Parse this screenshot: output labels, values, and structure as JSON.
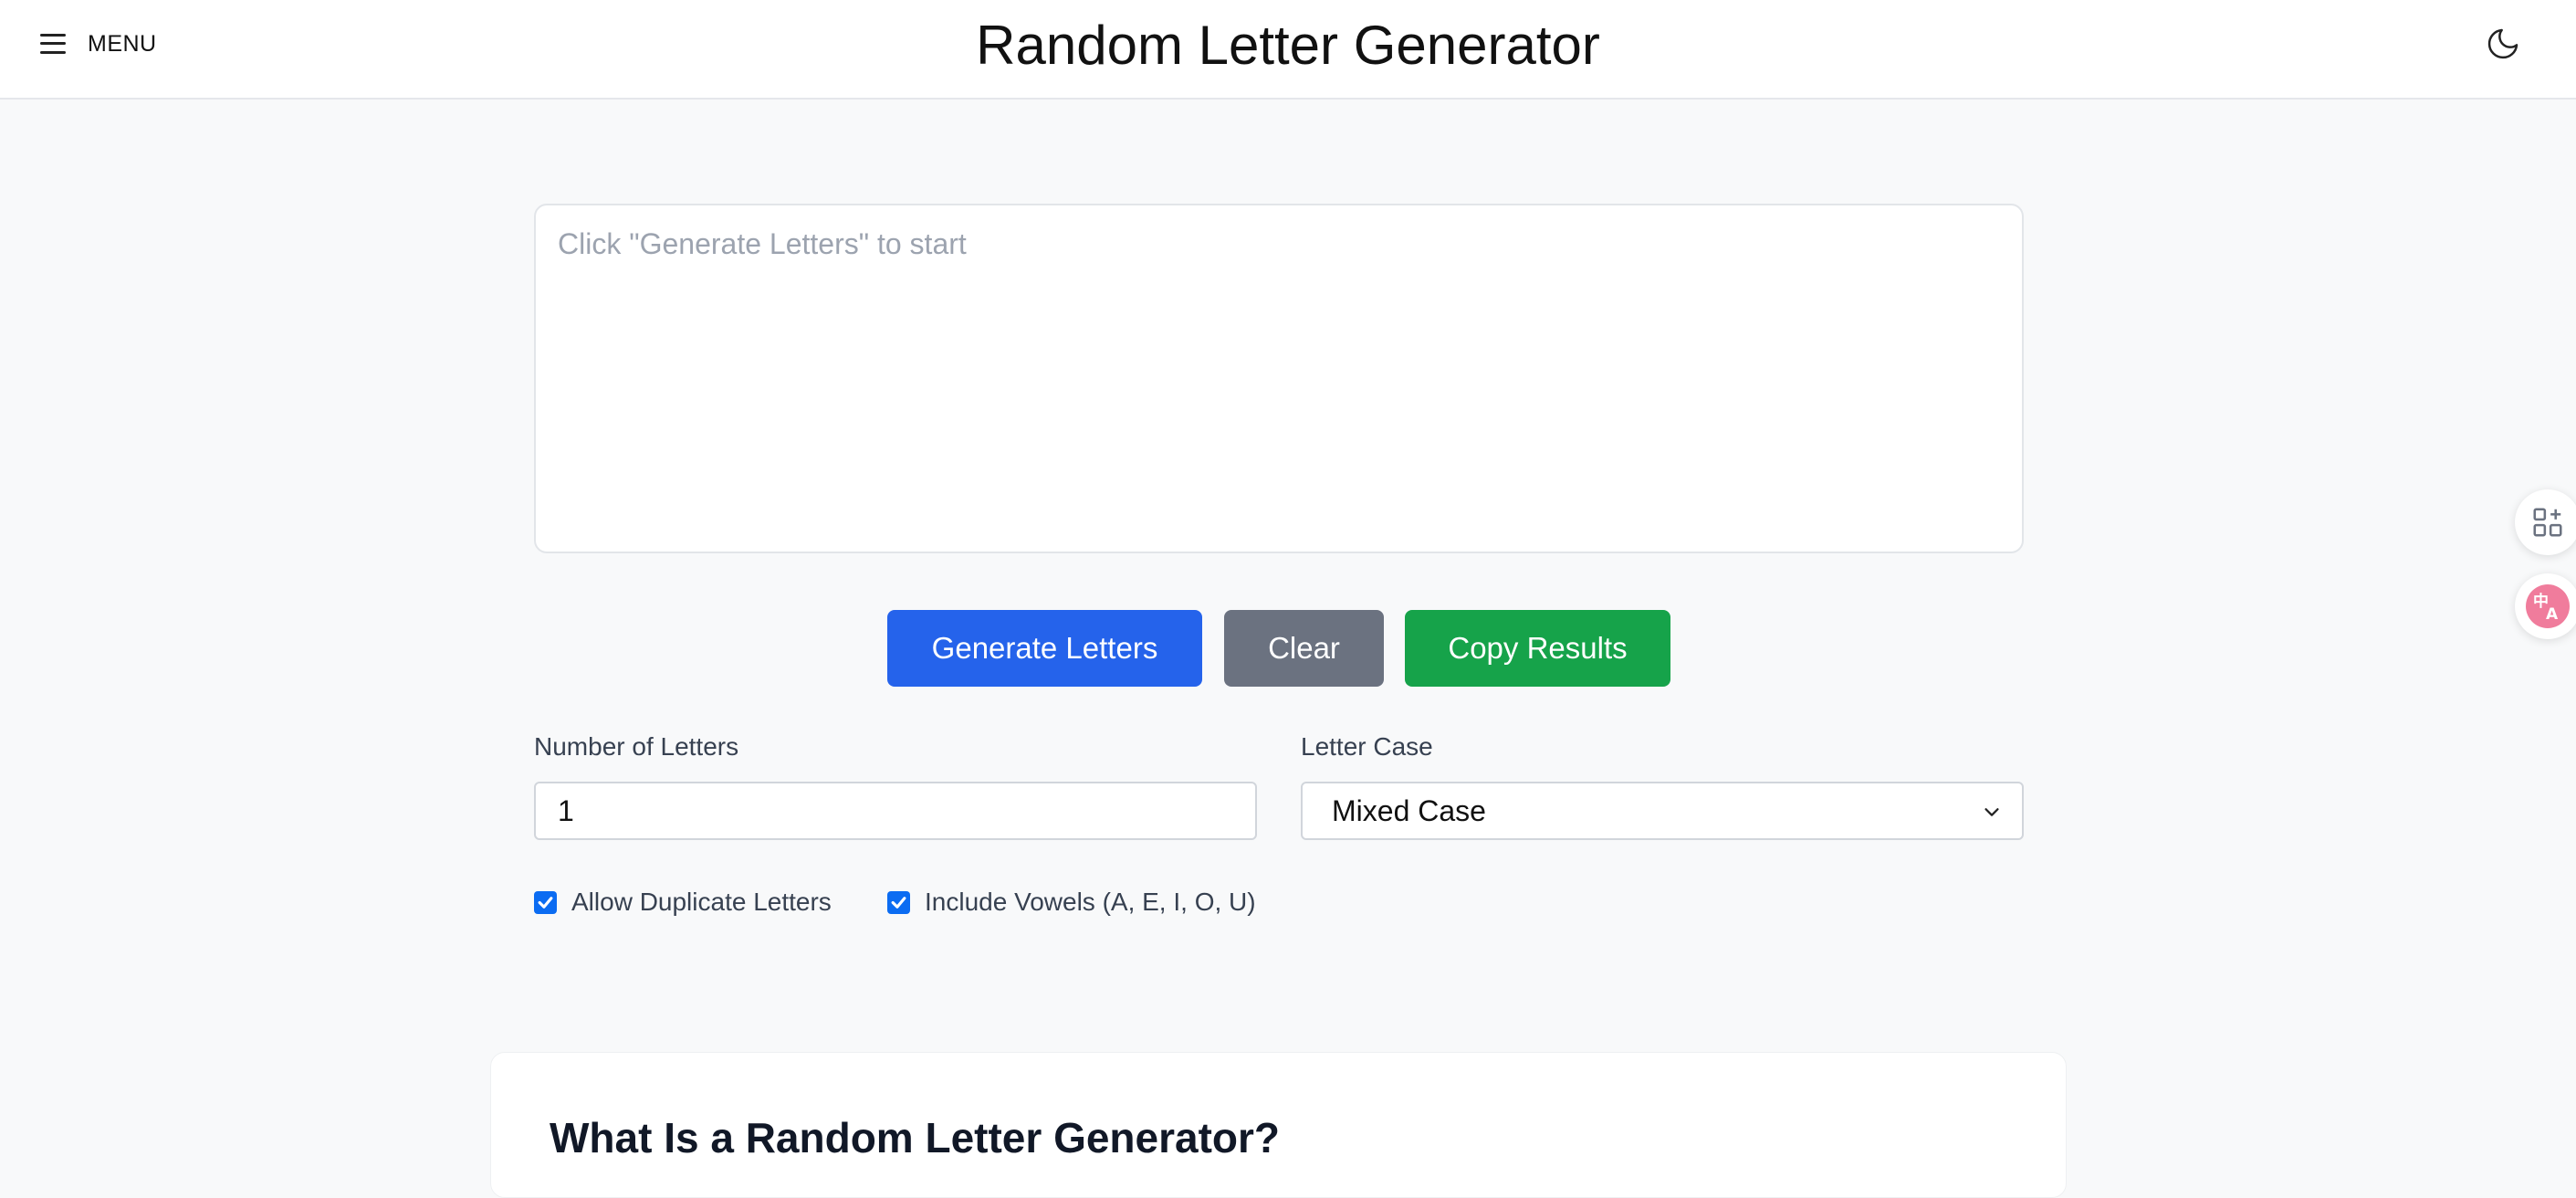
{
  "header": {
    "menu_label": "MENU",
    "title": "Random Letter Generator",
    "menu_icon": "hamburger-icon",
    "theme_icon": "moon-icon"
  },
  "output": {
    "placeholder": "Click \"Generate Letters\" to start",
    "value": ""
  },
  "actions": {
    "generate_label": "Generate Letters",
    "clear_label": "Clear",
    "copy_label": "Copy Results"
  },
  "settings": {
    "count_label": "Number of Letters",
    "count_value": "1",
    "case_label": "Letter Case",
    "case_selected": "Mixed Case",
    "allow_duplicates_label": "Allow Duplicate Letters",
    "allow_duplicates_checked": true,
    "include_vowels_label": "Include Vowels (A, E, I, O, U)",
    "include_vowels_checked": true
  },
  "side_tools": {
    "apps_icon": "apps-add-icon",
    "translate_icon": "translate-icon"
  },
  "article": {
    "title": "What Is a Random Letter Generator?"
  },
  "colors": {
    "generate": "#2563eb",
    "clear": "#6b7280",
    "copy": "#16a34a",
    "checkbox": "#0b6cf2",
    "translate_badge": "#f07c9c"
  }
}
